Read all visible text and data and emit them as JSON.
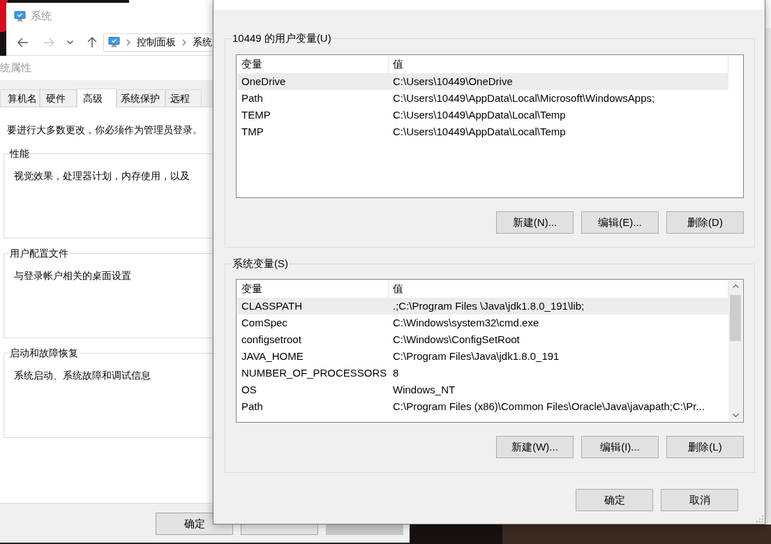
{
  "explorer_window": {
    "title": "系统",
    "nav_buttons": [
      {
        "kind": "back",
        "disabled": false
      },
      {
        "kind": "forward",
        "disabled": true
      },
      {
        "kind": "recent",
        "disabled": false
      },
      {
        "kind": "up",
        "disabled": false
      }
    ],
    "address_bar": {
      "crumbs": [
        "控制面板",
        "系统"
      ]
    }
  },
  "system_properties": {
    "title": "统属性",
    "tabs": [
      {
        "label": "算机名",
        "selected": false
      },
      {
        "label": "硬件",
        "selected": false
      },
      {
        "label": "高级",
        "selected": true
      },
      {
        "label": "系统保护",
        "selected": false
      },
      {
        "label": "远程",
        "selected": false
      }
    ],
    "notice": "要进行大多数更改，你必须作为管理员登录。",
    "groups": [
      {
        "title": "性能",
        "description": "视觉效果，处理器计划，内存使用，以及"
      },
      {
        "title": "用户配置文件",
        "description": "与登录帐户相关的桌面设置"
      },
      {
        "title": "启动和故障恢复",
        "description": "系统启动、系统故障和调试信息"
      }
    ],
    "buttons": [
      {
        "label": "确定",
        "disabled": false
      },
      {
        "disabled": false
      },
      {
        "disabled": true
      }
    ]
  },
  "environment_variables": {
    "user_variables": {
      "title": "10449 的用户变量(U)",
      "columns": [
        "变量",
        "值"
      ],
      "rows": [
        {
          "name": "OneDrive",
          "value": "C:\\Users\\10449\\OneDrive",
          "selected": true
        },
        {
          "name": "Path",
          "value": "C:\\Users\\10449\\AppData\\Local\\Microsoft\\WindowsApps;",
          "selected": false
        },
        {
          "name": "TEMP",
          "value": "C:\\Users\\10449\\AppData\\Local\\Temp",
          "selected": false
        },
        {
          "name": "TMP",
          "value": "C:\\Users\\10449\\AppData\\Local\\Temp",
          "selected": false
        }
      ],
      "buttons": [
        "新建(N)...",
        "编辑(E)...",
        "删除(D)"
      ]
    },
    "system_variables": {
      "title": "系统变量(S)",
      "columns": [
        "变量",
        "值"
      ],
      "rows": [
        {
          "name": "CLASSPATH",
          "value": ".;C:\\Program Files \\Java\\jdk1.8.0_191\\lib;",
          "selected": true
        },
        {
          "name": "ComSpec",
          "value": "C:\\Windows\\system32\\cmd.exe",
          "selected": false
        },
        {
          "name": "configsetroot",
          "value": "C:\\Windows\\ConfigSetRoot",
          "selected": false
        },
        {
          "name": "JAVA_HOME",
          "value": "C:\\Program Files\\Java\\jdk1.8.0_191",
          "selected": false
        },
        {
          "name": "NUMBER_OF_PROCESSORS",
          "value": "8",
          "selected": false
        },
        {
          "name": "OS",
          "value": "Windows_NT",
          "selected": false
        },
        {
          "name": "Path",
          "value": "C:\\Program Files (x86)\\Common Files\\Oracle\\Java\\javapath;C:\\Pr...",
          "selected": false
        }
      ],
      "buttons": [
        "新建(W)...",
        "编辑(I)...",
        "删除(L)"
      ]
    },
    "buttons": [
      "确定",
      "取消"
    ]
  }
}
